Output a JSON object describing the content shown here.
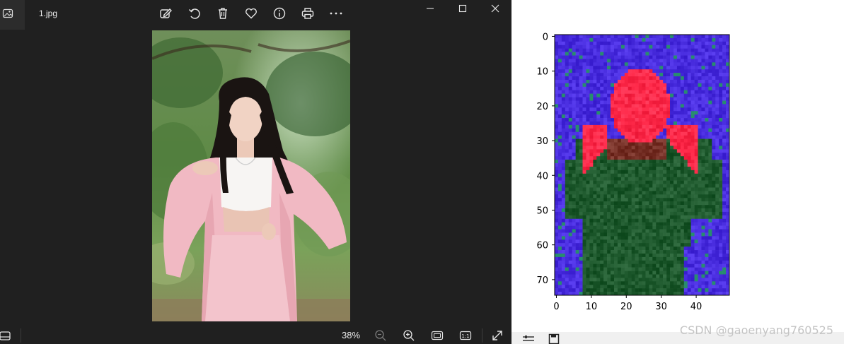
{
  "viewer": {
    "file_name": "1.jpg",
    "zoom_level": "38%",
    "toolbar_icons": [
      "edit-icon",
      "rotate-icon",
      "delete-icon",
      "favorite-icon",
      "info-icon",
      "print-icon",
      "more-icon"
    ],
    "window_controls": [
      "minimize-icon",
      "maximize-icon",
      "close-icon"
    ],
    "bottom_icons": [
      "filmstrip-icon",
      "zoom-out-icon",
      "zoom-in-icon",
      "fit-window-icon",
      "actual-size-icon",
      "fullscreen-icon"
    ],
    "actual_size_label": "1:1"
  },
  "chart_data": {
    "type": "heatmap",
    "description_source": "matplotlib imshow of a 75x50 pixel image",
    "x_ticks": [
      "0",
      "10",
      "20",
      "30",
      "40"
    ],
    "y_ticks": [
      "0",
      "10",
      "20",
      "30",
      "40",
      "50",
      "60",
      "70"
    ],
    "xlim": [
      -0.5,
      49.5
    ],
    "ylim": [
      74.5,
      -0.5
    ],
    "colors": {
      "background": "#4a2ee0",
      "hair": "#ff2a4a",
      "body": "#1f5a2e"
    }
  },
  "watermark": "CSDN @gaoenyang760525"
}
